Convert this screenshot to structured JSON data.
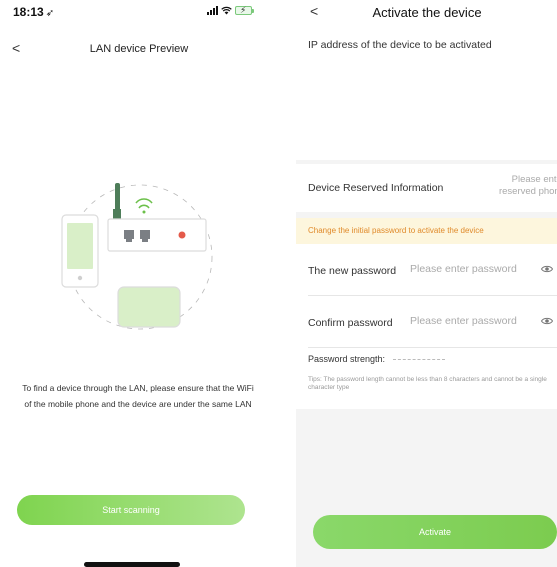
{
  "left_screen": {
    "status_bar": {
      "time": "18:13",
      "location_glyph": "➶"
    },
    "nav": {
      "back_glyph": "<",
      "title": "LAN device Preview"
    },
    "description": "To find a device through the LAN, please ensure that the WiFi of the mobile phone and the device are under the same LAN",
    "scan_button": "Start scanning"
  },
  "right_screen": {
    "nav": {
      "back_glyph": "<",
      "title": "Activate the device"
    },
    "ip_label": "IP address of the device to be activated",
    "reserved": {
      "label": "Device Reserved Information",
      "placeholder_line1": "Please enter",
      "placeholder_line2": "reserved phone"
    },
    "warning": "Change the initial password to activate the device",
    "new_password": {
      "label": "The new password",
      "placeholder": "Please enter password",
      "value": ""
    },
    "confirm_password": {
      "label": "Confirm password",
      "placeholder": "Please enter password",
      "value": ""
    },
    "strength_label": "Password strength:",
    "tips": "Tips: The password length cannot be less than 8 characters and cannot be a single character type",
    "activate_button": "Activate"
  },
  "colors": {
    "accent_green": "#7fd44f",
    "warning_text": "#e08a2a",
    "warning_bg": "#fdf6dd",
    "router_antenna": "#4e7d59",
    "device_screen": "#d9efc8"
  },
  "icons": {
    "location": "location-arrow-icon",
    "signal": "cellular-signal-icon",
    "wifi": "wifi-icon",
    "battery": "battery-charging-icon",
    "eye": "eye-icon"
  }
}
